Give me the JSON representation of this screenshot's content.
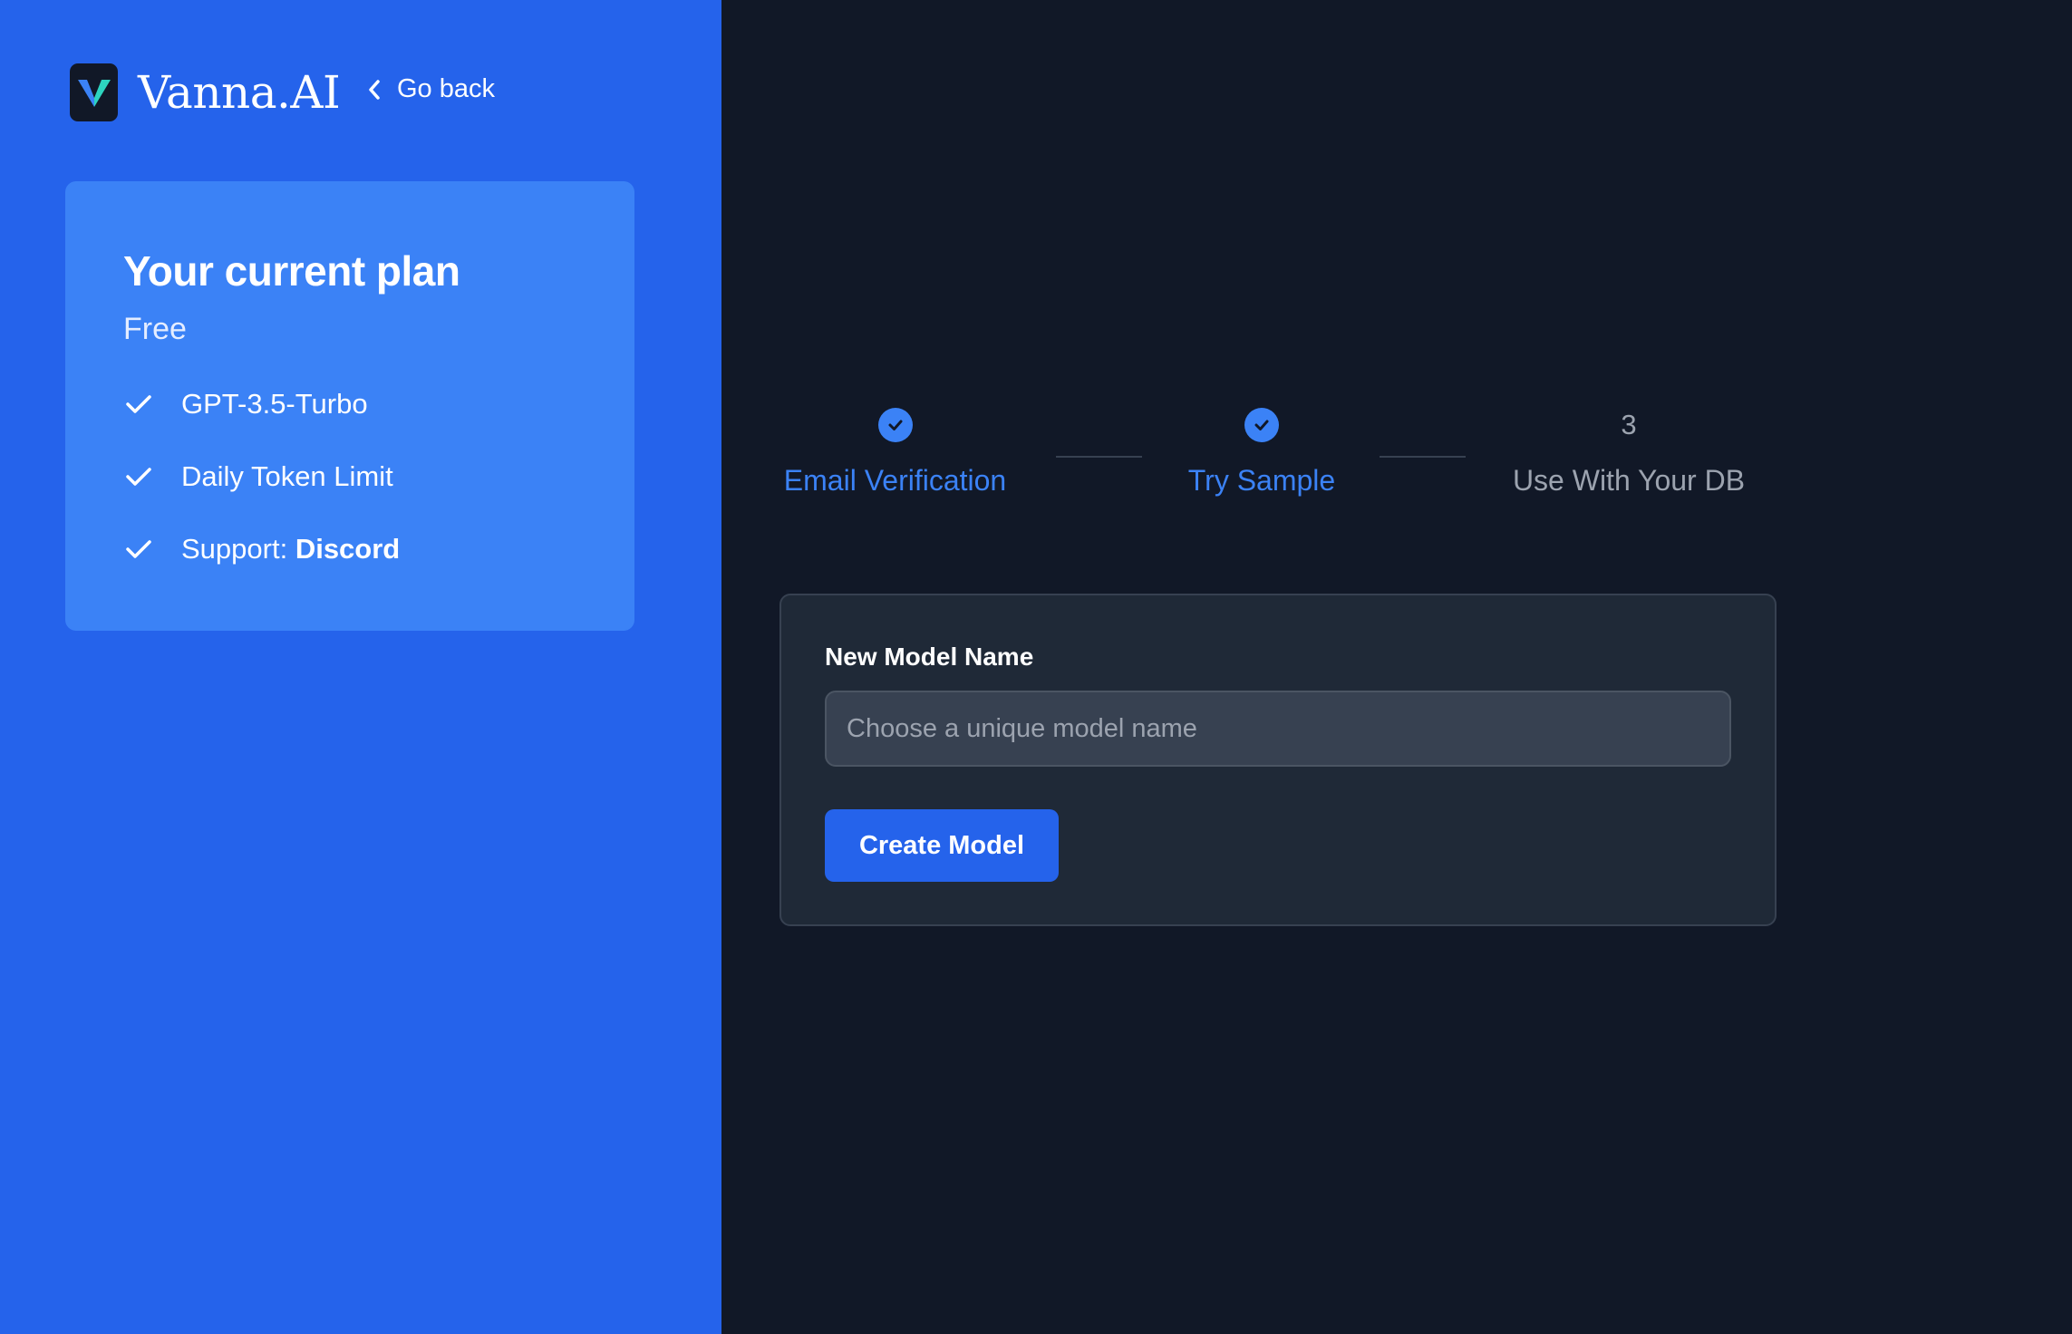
{
  "brand": {
    "name": "Vanna.AI",
    "logo_icon": "vanna-v-logo-icon",
    "logo_colors": {
      "background": "#111827",
      "mark_left": "#3b82f6",
      "mark_right": "#2dd4bf"
    }
  },
  "nav": {
    "go_back_label": "Go back",
    "go_back_icon": "chevron-left-icon"
  },
  "plan": {
    "title": "Your current plan",
    "tier": "Free",
    "features": [
      {
        "icon": "check-icon",
        "text": "GPT-3.5-Turbo"
      },
      {
        "icon": "check-icon",
        "text": "Daily Token Limit"
      },
      {
        "icon": "check-icon",
        "prefix": "Support: ",
        "strong": "Discord"
      }
    ]
  },
  "stepper": {
    "steps": [
      {
        "label": "Email Verification",
        "status": "complete",
        "icon": "check-circle-icon"
      },
      {
        "label": "Try Sample",
        "status": "complete",
        "icon": "check-circle-icon"
      },
      {
        "number": "3",
        "label": "Use With Your DB",
        "status": "pending"
      }
    ]
  },
  "form": {
    "field_label": "New Model Name",
    "input_value": "",
    "input_placeholder": "Choose a unique model name",
    "submit_label": "Create Model"
  },
  "colors": {
    "left_panel": "#2563eb",
    "plan_card": "#3b82f6",
    "page_background": "#111827",
    "form_card": "#1f2937",
    "accent": "#3b82f6",
    "muted": "#9ca3af"
  }
}
